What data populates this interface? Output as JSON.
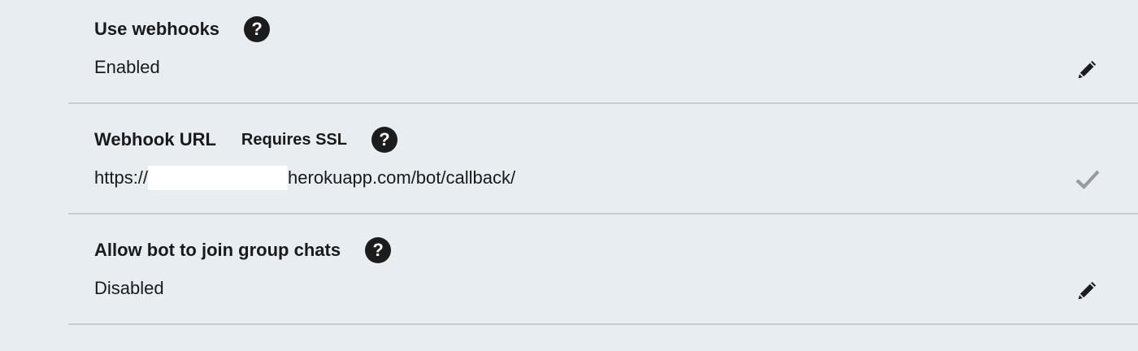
{
  "settings": {
    "use_webhooks": {
      "title": "Use webhooks",
      "value": "Enabled",
      "help_glyph": "?",
      "action_icon": "pencil-icon"
    },
    "webhook_url": {
      "title": "Webhook URL",
      "subtitle": "Requires SSL",
      "help_glyph": "?",
      "url_prefix": "https://",
      "url_suffix": "herokuapp.com/bot/callback/",
      "action_icon": "checkmark-icon"
    },
    "group_chats": {
      "title": "Allow bot to join group chats",
      "value": "Disabled",
      "help_glyph": "?",
      "action_icon": "pencil-icon"
    }
  },
  "colors": {
    "background": "#e8edf2",
    "divider": "#c7ccd2",
    "text": "#1a1a1a",
    "help_circle": "#1c1c1c",
    "check_gray": "#9a9a9a",
    "redaction": "#ffffff"
  }
}
